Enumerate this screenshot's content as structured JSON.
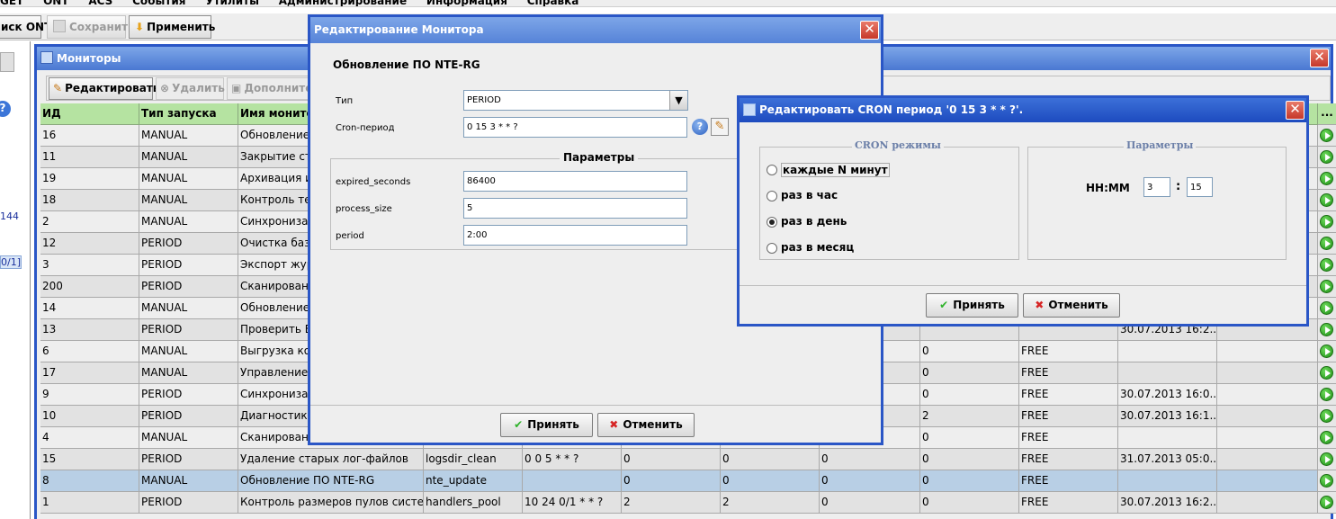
{
  "app": {
    "menu": [
      "GET",
      "ONT",
      "ACS",
      "События",
      "Утилиты",
      "Администрирование",
      "Информация",
      "Справка"
    ],
    "toolbar": {
      "ont_label": "иск ONT",
      "save_label": "Сохранить",
      "apply_label": "Применить"
    },
    "left_panel": {
      "text1": "144",
      "text2": "0/1]"
    }
  },
  "monitors": {
    "title": "Мониторы",
    "toolbar": {
      "edit_label": "Редактировать",
      "delete_label": "Удалить",
      "extra_label": "Дополнител"
    },
    "columns": [
      "ИД",
      "Тип запуска",
      "Имя монитор",
      "",
      "",
      "",
      "",
      "",
      "",
      "",
      "",
      "",
      "..."
    ],
    "rows": [
      [
        "16",
        "MANUAL",
        "Обновление П",
        "",
        "",
        "",
        "",
        "",
        "",
        "",
        "",
        ""
      ],
      [
        "11",
        "MANUAL",
        "Закрытие стар",
        "",
        "",
        "",
        "",
        "",
        "",
        "",
        "",
        ""
      ],
      [
        "19",
        "MANUAL",
        "Архивация и р",
        "",
        "",
        "",
        "",
        "",
        "",
        "",
        "",
        ""
      ],
      [
        "18",
        "MANUAL",
        "Контроль тем",
        "",
        "",
        "",
        "",
        "",
        "",
        "",
        "",
        ""
      ],
      [
        "2",
        "MANUAL",
        "Синхронизац",
        "",
        "",
        "",
        "",
        "",
        "",
        "",
        "",
        ""
      ],
      [
        "12",
        "PERIOD",
        "Очистка базы",
        "",
        "",
        "",
        "",
        "",
        "",
        "",
        "",
        ""
      ],
      [
        "3",
        "PERIOD",
        "Экспорт журн",
        "",
        "",
        "",
        "",
        "",
        "",
        "",
        "",
        ""
      ],
      [
        "200",
        "PERIOD",
        "Сканировани",
        "",
        "",
        "",
        "",
        "",
        "",
        "",
        "",
        ""
      ],
      [
        "14",
        "MANUAL",
        "Обновление П",
        "",
        "",
        "",
        "",
        "",
        "",
        "",
        "",
        ""
      ],
      [
        "13",
        "PERIOD",
        "Проверить БД",
        "",
        "",
        "",
        "",
        "",
        "",
        "",
        "30.07.2013 16:2...",
        ""
      ],
      [
        "6",
        "MANUAL",
        "Выгрузка конс",
        "",
        "",
        "",
        "",
        "",
        "0",
        "FREE",
        "",
        ""
      ],
      [
        "17",
        "MANUAL",
        "Управление а",
        "",
        "",
        "",
        "",
        "",
        "0",
        "FREE",
        "",
        ""
      ],
      [
        "9",
        "PERIOD",
        "Синхронизаци",
        "",
        "",
        "",
        "",
        "",
        "0",
        "FREE",
        "30.07.2013 16:0...",
        ""
      ],
      [
        "10",
        "PERIOD",
        "Диагностика о",
        "",
        "",
        "",
        "",
        "",
        "2",
        "FREE",
        "30.07.2013 16:1...",
        ""
      ],
      [
        "4",
        "MANUAL",
        "Сканировани",
        "",
        "",
        "",
        "",
        "",
        "0",
        "FREE",
        "",
        ""
      ],
      [
        "15",
        "PERIOD",
        "Удаление старых лог-файлов",
        "logsdir_clean",
        "0 0 5 * * ?",
        "0",
        "0",
        "0",
        "0",
        "FREE",
        "31.07.2013 05:0...",
        ""
      ],
      [
        "8",
        "MANUAL",
        "Обновление ПО NTE-RG",
        "nte_update",
        "",
        "0",
        "0",
        "0",
        "0",
        "FREE",
        "",
        ""
      ],
      [
        "1",
        "PERIOD",
        "Контроль размеров пулов системы",
        "handlers_pool",
        "10 24 0/1 * * ?",
        "2",
        "2",
        "0",
        "0",
        "FREE",
        "30.07.2013 16:2...",
        ""
      ]
    ]
  },
  "edit_dialog": {
    "title": "Редактирование Монитора",
    "heading": "Обновление ПО NTE-RG",
    "type_label": "Тип",
    "type_value": "PERIOD",
    "cron_label": "Cron-период",
    "cron_value": "0 15 3 * * ?",
    "params_legend": "Параметры",
    "params": [
      {
        "name": "expired_seconds",
        "value": "86400"
      },
      {
        "name": "process_size",
        "value": "5"
      },
      {
        "name": "period",
        "value": "2:00"
      }
    ],
    "ok_label": "Принять",
    "cancel_label": "Отменить"
  },
  "cron_dialog": {
    "title": "Редактировать CRON период '0 15 3 * * ?'.",
    "modes_legend": "CRON режимы",
    "modes": [
      "каждые N минут",
      "раз в час",
      "раз в день",
      "раз в месяц"
    ],
    "selected_mode": 2,
    "params_legend": "Параметры",
    "hhmm_label": "HH:MM",
    "hours": "3",
    "colon": ":",
    "minutes": "15",
    "ok_label": "Принять",
    "cancel_label": "Отменить"
  }
}
